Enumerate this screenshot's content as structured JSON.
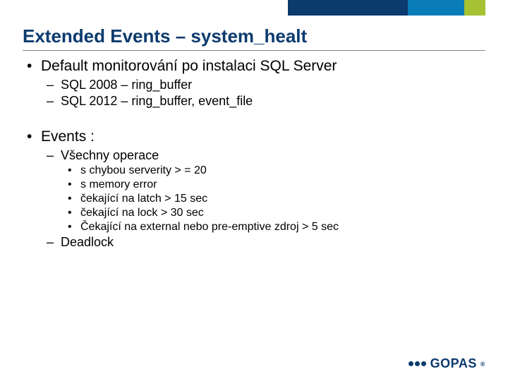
{
  "title": "Extended Events – system_healt",
  "bullets": {
    "b1": "Default monitorování po instalaci SQL Server",
    "b1_sub": {
      "s1": "SQL 2008 – ring_buffer",
      "s2": "SQL 2012 – ring_buffer, event_file"
    },
    "b2": "Events :",
    "b2_sub": {
      "s1": "Všechny operace",
      "s1_sub": {
        "i1": "s chybou serverity > = 20",
        "i2": "s memory error",
        "i3": "čekající na latch > 15 sec",
        "i4": "čekající na lock > 30 sec",
        "i5": "Čekající na external nebo pre-emptive zdroj > 5 sec"
      },
      "s2": "Deadlock"
    }
  },
  "brand": {
    "name": "GOPAS",
    "colors": {
      "navy": "#0b3a6e",
      "blue": "#0a7db8",
      "green": "#a6c233"
    }
  }
}
